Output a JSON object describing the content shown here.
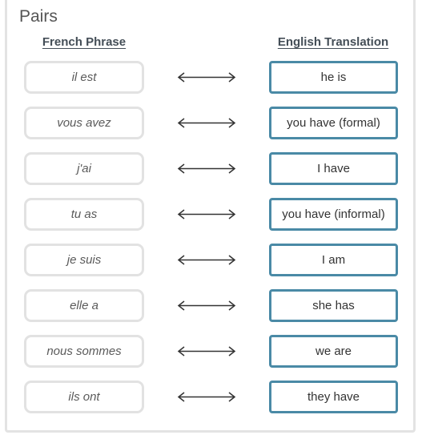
{
  "section_title": "Pairs",
  "columns": {
    "left_header": "French Phrase",
    "right_header": "English Translation"
  },
  "connector_icon": "double-headed-arrow",
  "colors": {
    "french_border": "#e2e2e2",
    "english_border": "#4a8aa6",
    "header_text": "#444e57"
  },
  "pairs": [
    {
      "french": "il est",
      "english": "he is"
    },
    {
      "french": "vous avez",
      "english": "you have (formal)"
    },
    {
      "french": "j'ai",
      "english": "I have"
    },
    {
      "french": "tu as",
      "english": "you have (informal)"
    },
    {
      "french": "je suis",
      "english": "I am"
    },
    {
      "french": "elle a",
      "english": "she has"
    },
    {
      "french": "nous sommes",
      "english": "we are"
    },
    {
      "french": "ils ont",
      "english": "they have"
    }
  ]
}
